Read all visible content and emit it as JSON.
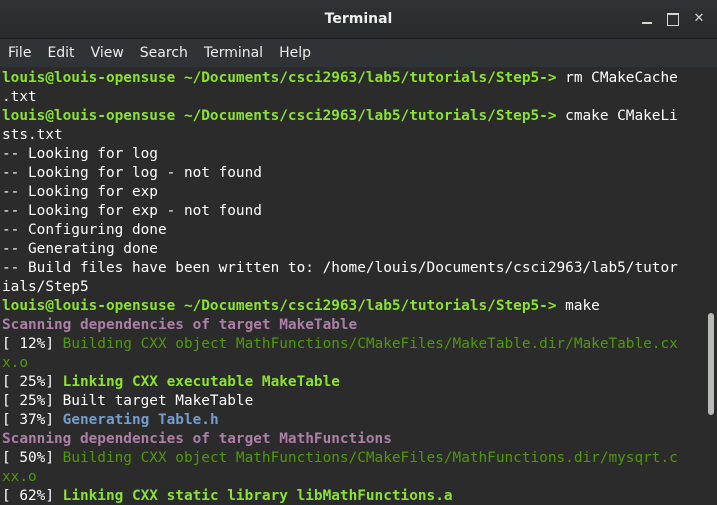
{
  "window": {
    "title": "Terminal",
    "minimize_icon": "minimize-icon",
    "maximize_icon": "maximize-icon",
    "close_icon": "close-icon",
    "close_glyph": "✕"
  },
  "menu": {
    "items": [
      "File",
      "Edit",
      "View",
      "Search",
      "Terminal",
      "Help"
    ]
  },
  "colors": {
    "background": "#2b2b2b",
    "prompt": "#8ae234",
    "magenta": "#ad7fa8",
    "green": "#4e9a06",
    "blue": "#729fcf",
    "text": "#ffffff"
  },
  "terminal": {
    "lines": [
      [
        {
          "t": "louis@louis-opensuse ~/Documents/csci2963/lab5/tutorials/Step5->",
          "c": "prompt"
        },
        {
          "t": " rm CMakeCache"
        }
      ],
      [
        {
          "t": ".txt"
        }
      ],
      [
        {
          "t": "louis@louis-opensuse ~/Documents/csci2963/lab5/tutorials/Step5->",
          "c": "prompt"
        },
        {
          "t": " cmake CMakeLi"
        }
      ],
      [
        {
          "t": "sts.txt"
        }
      ],
      [
        {
          "t": "-- Looking for log"
        }
      ],
      [
        {
          "t": "-- Looking for log - not found"
        }
      ],
      [
        {
          "t": "-- Looking for exp"
        }
      ],
      [
        {
          "t": "-- Looking for exp - not found"
        }
      ],
      [
        {
          "t": "-- Configuring done"
        }
      ],
      [
        {
          "t": "-- Generating done"
        }
      ],
      [
        {
          "t": "-- Build files have been written to: /home/louis/Documents/csci2963/lab5/tutor"
        }
      ],
      [
        {
          "t": "ials/Step5"
        }
      ],
      [
        {
          "t": "louis@louis-opensuse ~/Documents/csci2963/lab5/tutorials/Step5->",
          "c": "prompt"
        },
        {
          "t": " make"
        }
      ],
      [
        {
          "t": "Scanning dependencies of target MakeTable",
          "c": "magenta"
        }
      ],
      [
        {
          "t": "[ 12%] "
        },
        {
          "t": "Building CXX object MathFunctions/CMakeFiles/MakeTable.dir/MakeTable.cx",
          "c": "green"
        }
      ],
      [
        {
          "t": "x.o",
          "c": "green"
        }
      ],
      [
        {
          "t": "[ 25%] "
        },
        {
          "t": "Linking CXX executable MakeTable",
          "c": "bgreen"
        }
      ],
      [
        {
          "t": "[ 25%] Built target MakeTable"
        }
      ],
      [
        {
          "t": "[ 37%] "
        },
        {
          "t": "Generating Table.h",
          "c": "blue"
        }
      ],
      [
        {
          "t": "Scanning dependencies of target MathFunctions",
          "c": "magenta"
        }
      ],
      [
        {
          "t": "[ 50%] "
        },
        {
          "t": "Building CXX object MathFunctions/CMakeFiles/MathFunctions.dir/mysqrt.c",
          "c": "green"
        }
      ],
      [
        {
          "t": "xx.o",
          "c": "green"
        }
      ],
      [
        {
          "t": "[ 62%] "
        },
        {
          "t": "Linking CXX static library libMathFunctions.a",
          "c": "bgreen"
        }
      ]
    ]
  }
}
